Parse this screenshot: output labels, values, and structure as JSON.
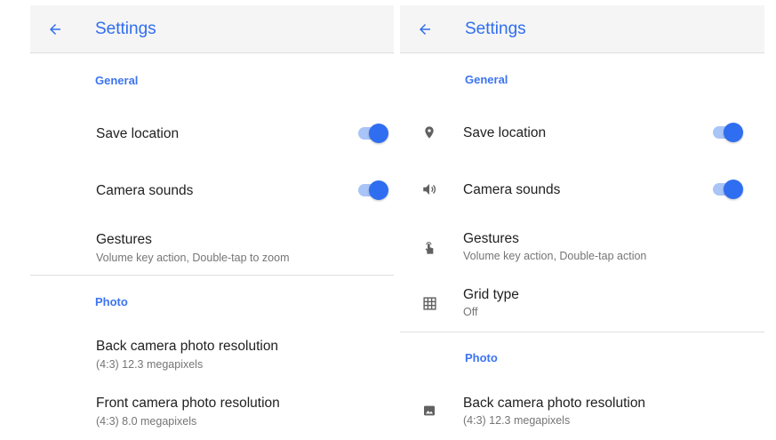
{
  "left": {
    "title": "Settings",
    "general_header": "General",
    "save_location": "Save location",
    "camera_sounds": "Camera sounds",
    "gestures_title": "Gestures",
    "gestures_sub": "Volume key action, Double-tap to zoom",
    "photo_header": "Photo",
    "back_res_title": "Back camera photo resolution",
    "back_res_sub": "(4:3) 12.3 megapixels",
    "front_res_title": "Front camera photo resolution",
    "front_res_sub": "(4:3) 8.0 megapixels",
    "save_location_on": true,
    "camera_sounds_on": true
  },
  "right": {
    "title": "Settings",
    "general_header": "General",
    "save_location": "Save location",
    "camera_sounds": "Camera sounds",
    "gestures_title": "Gestures",
    "gestures_sub": "Volume key action, Double-tap action",
    "grid_title": "Grid type",
    "grid_sub": "Off",
    "photo_header": "Photo",
    "back_res_title": "Back camera photo resolution",
    "back_res_sub": "(4:3) 12.3 megapixels",
    "save_location_on": true,
    "camera_sounds_on": true
  },
  "icons": {
    "back": "arrow-back-icon",
    "location": "location-pin-icon",
    "sound": "volume-icon",
    "gestures": "touch-gesture-icon",
    "grid": "grid-icon",
    "photo": "photo-icon"
  },
  "colors": {
    "accent": "#2f6ef0",
    "toggle_track": "#a9c4f7",
    "appbar_bg": "#f5f5f5",
    "secondary_text": "#757575",
    "icon_gray": "#616161"
  }
}
